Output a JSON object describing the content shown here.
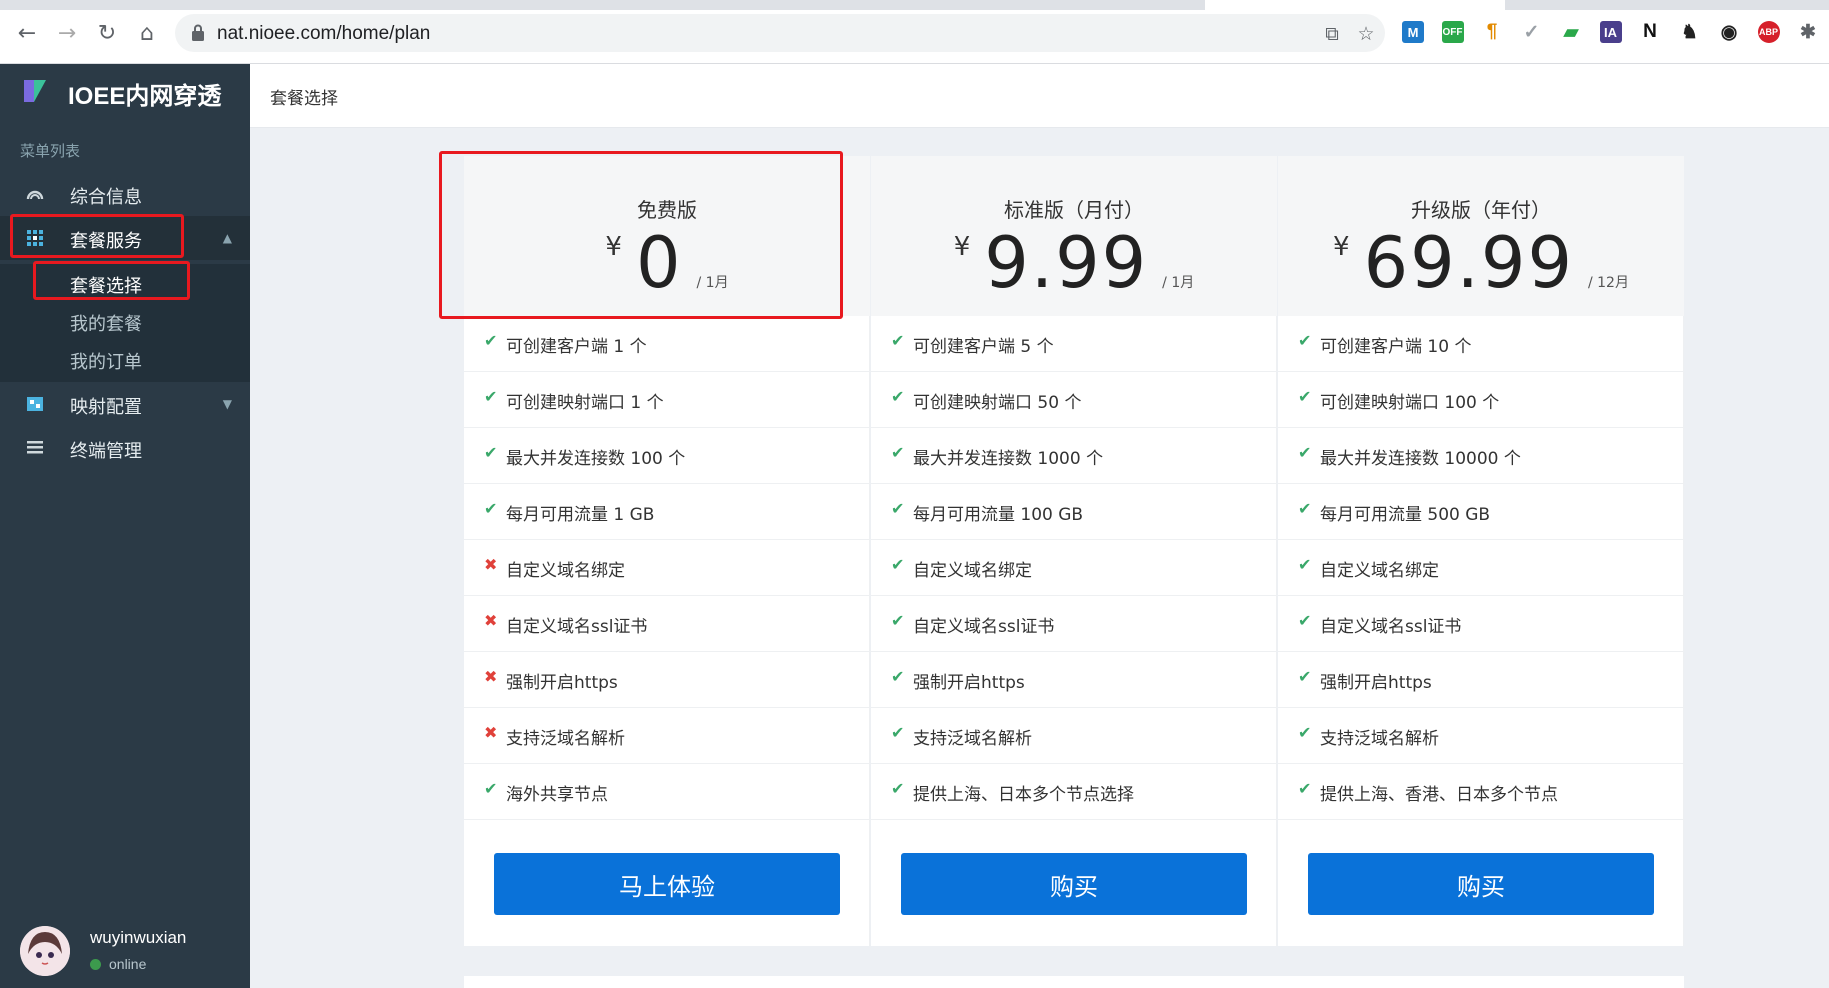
{
  "browser": {
    "url": "nat.nioee.com/home/plan",
    "extensions": [
      {
        "name": "M",
        "color": "#1f7ac9"
      },
      {
        "name": "OFF",
        "color": "#2aa84a"
      },
      {
        "name": "¶",
        "color": "#e28a00"
      },
      {
        "name": "✓",
        "color": "#9aa0a6"
      },
      {
        "name": "▰",
        "color": "#2aa84a"
      },
      {
        "name": "IA",
        "color": "#4a3f8c"
      },
      {
        "name": "N",
        "color": "#111111"
      },
      {
        "name": "♞",
        "color": "#222222"
      },
      {
        "name": "◉",
        "color": "#222222"
      },
      {
        "name": "ABP",
        "color": "#d6202a"
      },
      {
        "name": "✱",
        "color": "#5f6368"
      }
    ]
  },
  "sidebar": {
    "brand": "IOEE内网穿透",
    "menu_header": "菜单列表",
    "items": [
      {
        "label": "综合信息",
        "icon": "dashboard-icon"
      },
      {
        "label": "套餐服务",
        "icon": "grid-icon"
      },
      {
        "label": "映射配置",
        "icon": "mapping-icon"
      },
      {
        "label": "终端管理",
        "icon": "list-icon"
      }
    ],
    "subitems": [
      "套餐选择",
      "我的套餐",
      "我的订单"
    ],
    "user": {
      "name": "wuyinwuxian",
      "status": "online"
    }
  },
  "header": {
    "breadcrumb": "套餐选择"
  },
  "plans": [
    {
      "title": "免费版",
      "currency": "¥",
      "price": "0",
      "period": "/ 1月",
      "button": "马上体验",
      "features": [
        {
          "text": "可创建客户端 1 个",
          "ok": true
        },
        {
          "text": "可创建映射端口 1 个",
          "ok": true
        },
        {
          "text": "最大并发连接数 100 个",
          "ok": true
        },
        {
          "text": "每月可用流量 1 GB",
          "ok": true
        },
        {
          "text": "自定义域名绑定",
          "ok": false
        },
        {
          "text": "自定义域名ssl证书",
          "ok": false
        },
        {
          "text": "强制开启https",
          "ok": false
        },
        {
          "text": "支持泛域名解析",
          "ok": false
        },
        {
          "text": "海外共享节点",
          "ok": true
        }
      ]
    },
    {
      "title": "标准版（月付）",
      "currency": "¥",
      "price": "9.99",
      "period": "/ 1月",
      "button": "购买",
      "features": [
        {
          "text": "可创建客户端 5 个",
          "ok": true
        },
        {
          "text": "可创建映射端口 50 个",
          "ok": true
        },
        {
          "text": "最大并发连接数 1000 个",
          "ok": true
        },
        {
          "text": "每月可用流量 100 GB",
          "ok": true
        },
        {
          "text": "自定义域名绑定",
          "ok": true
        },
        {
          "text": "自定义域名ssl证书",
          "ok": true
        },
        {
          "text": "强制开启https",
          "ok": true
        },
        {
          "text": "支持泛域名解析",
          "ok": true
        },
        {
          "text": "提供上海、日本多个节点选择",
          "ok": true
        }
      ]
    },
    {
      "title": "升级版（年付）",
      "currency": "¥",
      "price": "69.99",
      "period": "/ 12月",
      "button": "购买",
      "features": [
        {
          "text": "可创建客户端 10 个",
          "ok": true
        },
        {
          "text": "可创建映射端口 100 个",
          "ok": true
        },
        {
          "text": "最大并发连接数 10000 个",
          "ok": true
        },
        {
          "text": "每月可用流量 500 GB",
          "ok": true
        },
        {
          "text": "自定义域名绑定",
          "ok": true
        },
        {
          "text": "自定义域名ssl证书",
          "ok": true
        },
        {
          "text": "强制开启https",
          "ok": true
        },
        {
          "text": "支持泛域名解析",
          "ok": true
        },
        {
          "text": "提供上海、香港、日本多个节点",
          "ok": true
        }
      ]
    }
  ],
  "marks": {
    "ok": "✔",
    "no": "✖"
  },
  "colors": {
    "accent": "#0a72d9",
    "sidebar": "#2b3a46",
    "highlight": "#e8191f",
    "ok": "#3aa86a",
    "no": "#e0413a"
  }
}
